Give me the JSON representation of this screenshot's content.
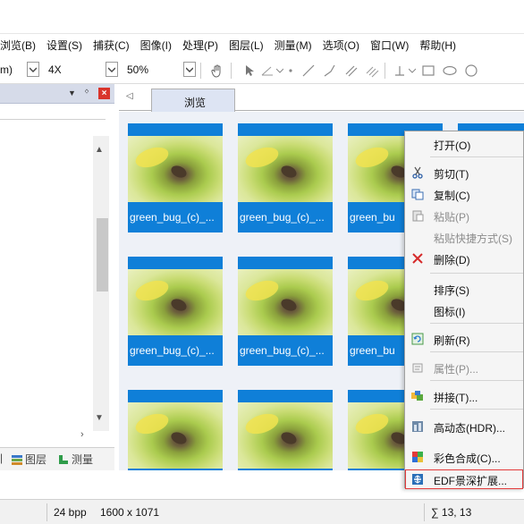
{
  "menu": [
    "浏览(B)",
    "设置(S)",
    "捕获(C)",
    "图像(I)",
    "处理(P)",
    "图层(L)",
    "测量(M)",
    "选项(O)",
    "窗口(W)",
    "帮助(H)"
  ],
  "toolbar": {
    "unit_value": "m)",
    "magnification": "4X",
    "zoom": "50%",
    "icons": [
      "hand-icon",
      "pointer-icon",
      "angle-icon",
      "point-icon",
      "line-icon",
      "polyline-icon",
      "parallel-lines-icon",
      "multi-parallel-icon",
      "perpendicular-icon",
      "rectangle-icon",
      "ellipse-icon",
      "circle-icon"
    ]
  },
  "left_panel": {
    "tabs": [
      "图层",
      "测量"
    ]
  },
  "tabs": {
    "active": "浏览"
  },
  "thumbnails": [
    {
      "caption": "green_bug_(c)_..."
    },
    {
      "caption": "green_bug_(c)_..."
    },
    {
      "caption": "green_bu"
    },
    {
      "caption": ""
    },
    {
      "caption": "green_bug_(c)_..."
    },
    {
      "caption": "green_bug_(c)_..."
    },
    {
      "caption": "green_bu"
    },
    {
      "caption": ""
    },
    {
      "caption": ""
    },
    {
      "caption": ""
    },
    {
      "caption": ""
    },
    {
      "caption": ""
    }
  ],
  "context_menu": {
    "open": "打开(O)",
    "cut": "剪切(T)",
    "copy": "复制(C)",
    "paste": "粘贴(P)",
    "paste_shortcut": "粘贴快捷方式(S)",
    "delete": "删除(D)",
    "sort": "排序(S)",
    "icons": "图标(I)",
    "refresh": "刷新(R)",
    "properties": "属性(P)...",
    "stitch": "拼接(T)...",
    "hdr": "高动态(HDR)...",
    "color_composite": "彩色合成(C)...",
    "edf": "EDF景深扩展..."
  },
  "status": {
    "bpp": "24 bpp",
    "size": "1600 x 1071",
    "sigma": "∑ 13, 13"
  },
  "colors": {
    "thumb_blue": "#0f7fd8",
    "highlight_red": "#e23a3a",
    "panel_head": "#d6dbe9"
  }
}
